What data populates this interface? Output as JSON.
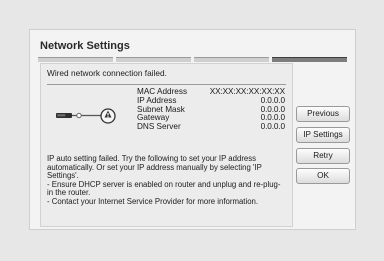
{
  "dialog": {
    "title": "Network Settings",
    "progress": {
      "steps_total": 4,
      "current_step": 4
    },
    "status": "Wired network connection failed.",
    "info": [
      {
        "label": "MAC Address",
        "value": "XX:XX:XX:XX:XX:XX"
      },
      {
        "label": "IP Address",
        "value": "0.0.0.0"
      },
      {
        "label": "Subnet Mask",
        "value": "0.0.0.0"
      },
      {
        "label": "Gateway",
        "value": "0.0.0.0"
      },
      {
        "label": "DNS Server",
        "value": "0.0.0.0"
      }
    ],
    "message": [
      "IP auto setting failed. Try the following to set your IP address automatically. Or set your IP address manually by selecting 'IP Settings'.",
      "- Ensure DHCP server is enabled on router and unplug and re-plug-in the router.",
      "- Contact your Internet Service Provider for more information."
    ],
    "buttons": {
      "previous": "Previous",
      "ip_settings": "IP Settings",
      "retry": "Retry",
      "ok": "OK"
    }
  },
  "icons": {
    "connection": "network-failure-icon"
  }
}
